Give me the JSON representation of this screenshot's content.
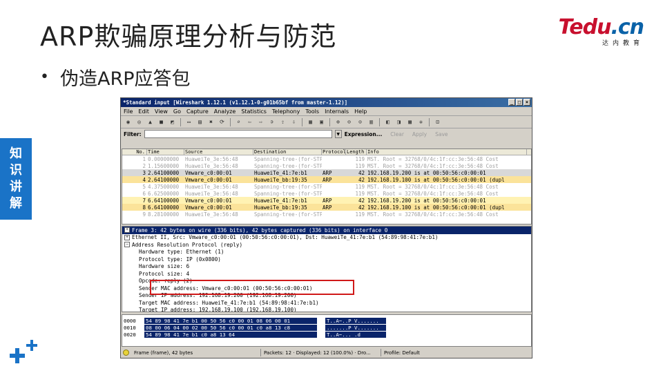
{
  "slide": {
    "title": "ARP欺骗原理分析与防范",
    "bullet": "伪造ARP应答包",
    "side_tab": [
      "知",
      "识",
      "讲",
      "解"
    ],
    "logo": {
      "brand_left": "Tedu",
      "brand_dot": ".",
      "brand_right": "cn",
      "sub": "达内教育"
    }
  },
  "window": {
    "title": "*Standard input   [Wireshark 1.12.1  (v1.12.1-0-g01b65bf from master-1.12)]",
    "controls": [
      "_",
      "□",
      "×"
    ],
    "menu": [
      "File",
      "Edit",
      "View",
      "Go",
      "Capture",
      "Analyze",
      "Statistics",
      "Telephony",
      "Tools",
      "Internals",
      "Help"
    ],
    "toolbar_icons": [
      "interface-list-icon",
      "capture-options-icon",
      "start-capture-icon",
      "stop-capture-icon",
      "restart-capture-icon",
      "open-file-icon",
      "save-file-icon",
      "close-file-icon",
      "reload-icon",
      "find-icon",
      "go-back-icon",
      "go-forward-icon",
      "go-to-packet-icon",
      "first-packet-icon",
      "last-packet-icon",
      "colorize-icon",
      "auto-scroll-icon",
      "zoom-in-icon",
      "zoom-out-icon",
      "normal-size-icon",
      "resize-columns-icon",
      "capture-filters-icon",
      "display-filters-icon",
      "coloring-rules-icon",
      "preferences-icon",
      "help-icon"
    ],
    "filter": {
      "label": "Filter:",
      "value": "",
      "expression": "Expression...",
      "clear": "Clear",
      "apply": "Apply",
      "save": "Save"
    },
    "columns": [
      "No.",
      "Time",
      "Source",
      "Destination",
      "Protocol",
      "Length",
      "Info"
    ],
    "packets": [
      {
        "no": "1",
        "time": "0.00000000",
        "src": "HuaweiTe_3e:56:48",
        "dst": "Spanning-tree-(for-STP",
        "proto": "",
        "len": "119",
        "info": "MST. Root = 32768/0/4c:1f:cc:3e:56:48  Cost",
        "style": "stp"
      },
      {
        "no": "2",
        "time": "1.15600000",
        "src": "HuaweiTe_3e:56:48",
        "dst": "Spanning-tree-(for-STP",
        "proto": "",
        "len": "119",
        "info": "MST. Root = 32768/0/4c:1f:cc:3e:56:48  Cost",
        "style": "stp"
      },
      {
        "no": "3",
        "time": "2.64100000",
        "src": "Vmware_c0:00:01",
        "dst": "HuaweiTe_41:7e:b1",
        "proto": "ARP",
        "len": "42",
        "info": "192.168.19.200 is at 00:50:56:c0:00:01",
        "style": "sel"
      },
      {
        "no": "4",
        "time": "2.64100000",
        "src": "Vmware_c0:00:01",
        "dst": "HuaweiTe_bb:19:35",
        "proto": "ARP",
        "len": "42",
        "info": "192.168.19.100 is at 00:50:56:c0:00:01  (dupl",
        "style": "arp-b"
      },
      {
        "no": "5",
        "time": "4.37500000",
        "src": "HuaweiTe_3e:56:48",
        "dst": "Spanning-tree-(for-STP",
        "proto": "",
        "len": "119",
        "info": "MST. Root = 32768/0/4c:1f:cc:3e:56:48  Cost",
        "style": "stp"
      },
      {
        "no": "6",
        "time": "6.62500000",
        "src": "HuaweiTe_3e:56:48",
        "dst": "Spanning-tree-(for-STP",
        "proto": "",
        "len": "119",
        "info": "MST. Root = 32768/0/4c:1f:cc:3e:56:48  Cost",
        "style": "stp"
      },
      {
        "no": "7",
        "time": "6.64100000",
        "src": "Vmware_c0:00:01",
        "dst": "HuaweiTe_41:7e:b1",
        "proto": "ARP",
        "len": "42",
        "info": "192.168.19.200 is at 00:50:56:c0:00:01",
        "style": "arp-a"
      },
      {
        "no": "8",
        "time": "6.64100000",
        "src": "Vmware_c0:00:01",
        "dst": "HuaweiTe_bb:19:35",
        "proto": "ARP",
        "len": "42",
        "info": "192.168.19.100 is at 00:50:56:c0:00:01  (dupl",
        "style": "arp-b"
      },
      {
        "no": "9",
        "time": "8.28100000",
        "src": "HuaweiTe_3e:56:48",
        "dst": "Spanning-tree-(for-STP",
        "proto": "",
        "len": "119",
        "info": "MST. Root = 32768/0/4c:1f:cc:3e:56:48  Cost",
        "style": "stp"
      }
    ],
    "details": [
      {
        "text": "Frame 3: 42 bytes on wire (336 bits), 42 bytes captured (336 bits) on interface 0",
        "toggle": "+",
        "sel": true
      },
      {
        "text": "Ethernet II, Src: Vmware_c0:00:01 (00:50:56:c0:00:01), Dst: HuaweiTe_41:7e:b1 (54:89:98:41:7e:b1)",
        "toggle": "+"
      },
      {
        "text": "Address Resolution Protocol (reply)",
        "toggle": "−"
      },
      {
        "text": "Hardware type: Ethernet (1)",
        "indent": true
      },
      {
        "text": "Protocol type: IP (0x0800)",
        "indent": true
      },
      {
        "text": "Hardware size: 6",
        "indent": true
      },
      {
        "text": "Protocol size: 4",
        "indent": true
      },
      {
        "text": "Opcode: reply (2)",
        "indent": true
      },
      {
        "text": "Sender MAC address: Vmware_c0:00:01 (00:50:56:c0:00:01)",
        "indent": true
      },
      {
        "text": "Sender IP address: 192.168.19.200 (192.168.19.200)",
        "indent": true
      },
      {
        "text": "Target MAC address: HuaweiTe_41:7e:b1 (54:89:98:41:7e:b1)",
        "indent": true
      },
      {
        "text": "Target IP address: 192.168.19.100 (192.168.19.100)",
        "indent": true
      }
    ],
    "hex": [
      {
        "off": "0000",
        "bytes": "54 89 98 41 7e b1 00 50  56 c0 00 01 08 06 00 01",
        "ascii": "T..A~..P V......."
      },
      {
        "off": "0010",
        "bytes": "08 00 06 04 00 02 00 50  56 c0 00 01 c0 a8 13 c8",
        "ascii": ".......P V......."
      },
      {
        "off": "0020",
        "bytes": "54 89 98 41 7e b1 c0 a8  13 64",
        "ascii": "T..A~... .d"
      }
    ],
    "status": {
      "frame": "Frame (frame), 42 bytes",
      "packets": "Packets: 12 · Displayed: 12 (100.0%) · Dro...",
      "profile": "Profile: Default"
    }
  }
}
